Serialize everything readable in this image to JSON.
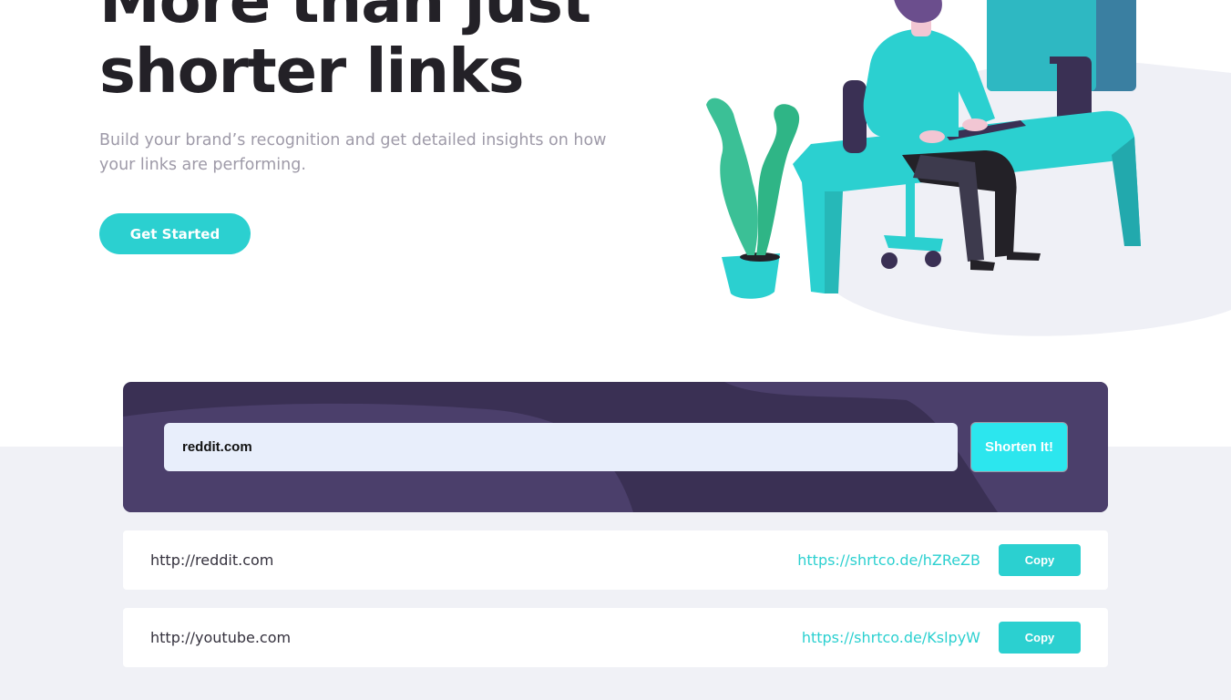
{
  "hero": {
    "title_line1": "More than just",
    "title_line2": "shorter links",
    "subtitle": "Build your brand’s recognition and get detailed insights on how your links are performing.",
    "cta_label": "Get Started"
  },
  "shorten": {
    "input_value": "reddit.com",
    "button_label": "Shorten It!"
  },
  "results": [
    {
      "original": "http://reddit.com",
      "short": "https://shrtco.de/hZReZB",
      "copy_label": "Copy"
    },
    {
      "original": "http://youtube.com",
      "short": "https://shrtco.de/KslpyW",
      "copy_label": "Copy"
    }
  ],
  "illustration": {
    "icon": "person-working-at-desk-illustration"
  },
  "colors": {
    "primary_cyan": "#2bd0d0",
    "dark_violet": "#3a3054",
    "very_dark_text": "#232127",
    "gray_text": "#9e9aa8",
    "light_bg": "#f0f1f6"
  }
}
